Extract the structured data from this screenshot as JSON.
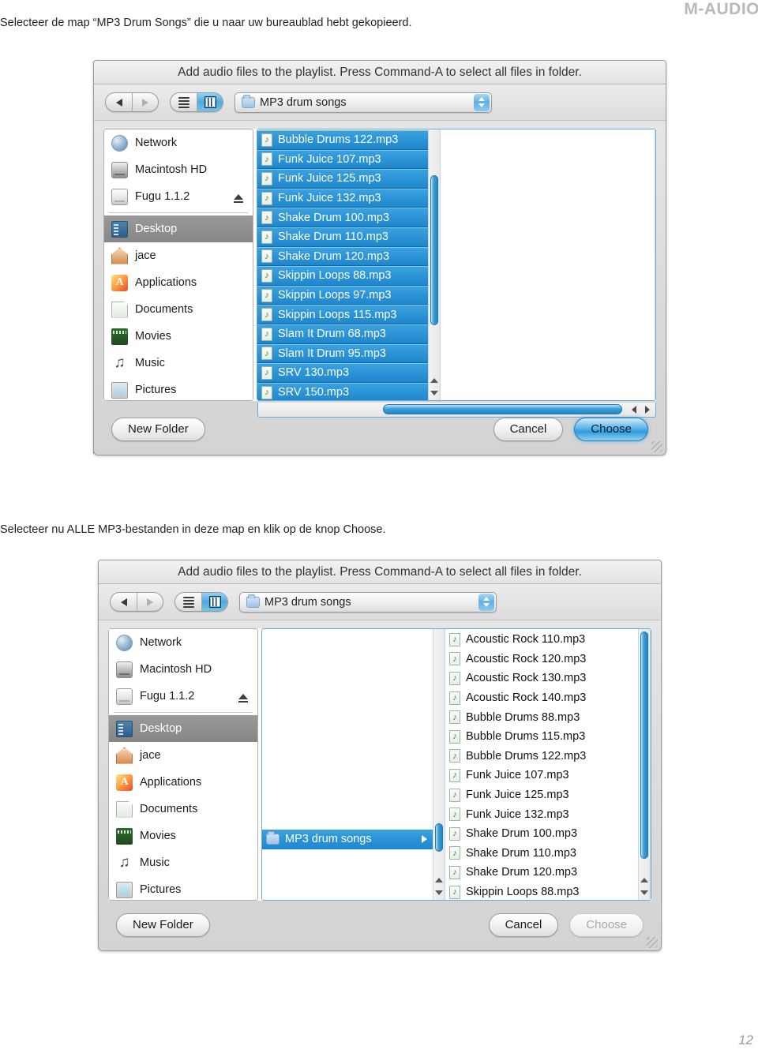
{
  "brand": {
    "logo_text": "M-AUDIO"
  },
  "page": {
    "number": "12"
  },
  "instructions": {
    "line1": "Selecteer de map “MP3 Drum Songs” die u naar uw bureaublad hebt gekopieerd.",
    "line2": "Selecteer nu ALLE MP3-bestanden in deze map en klik op de knop Choose."
  },
  "dialog1": {
    "title": "Add audio files to the playlist. Press Command-A to select all files in folder.",
    "toolbar": {
      "back_icon": "triangle-left-icon",
      "forward_icon": "triangle-right-icon",
      "view_list_icon": "list-view-icon",
      "view_column_icon": "column-view-icon",
      "path_popup_value": "MP3 drum songs",
      "path_popup_icon": "folder-icon",
      "path_popup_arrows_icon": "updown-arrows-icon"
    },
    "sidebar": [
      {
        "label": "Network",
        "icon": "network-globe-icon",
        "selected": false,
        "eject": false
      },
      {
        "label": "Macintosh HD",
        "icon": "hard-disk-icon",
        "selected": false,
        "eject": false
      },
      {
        "label": "Fugu 1.1.2",
        "icon": "removable-disk-icon",
        "selected": false,
        "eject": true
      },
      {
        "label": "Desktop",
        "icon": "desktop-icon",
        "selected": true,
        "eject": false
      },
      {
        "label": "jace",
        "icon": "home-icon",
        "selected": false,
        "eject": false
      },
      {
        "label": "Applications",
        "icon": "applications-icon",
        "selected": false,
        "eject": false
      },
      {
        "label": "Documents",
        "icon": "documents-icon",
        "selected": false,
        "eject": false
      },
      {
        "label": "Movies",
        "icon": "movies-icon",
        "selected": false,
        "eject": false
      },
      {
        "label": "Music",
        "icon": "music-icon",
        "selected": false,
        "eject": false
      },
      {
        "label": "Pictures",
        "icon": "pictures-icon",
        "selected": false,
        "eject": false
      }
    ],
    "files": [
      {
        "name": "Bubble Drums 122.mp3",
        "selected": true
      },
      {
        "name": "Funk Juice 107.mp3",
        "selected": true
      },
      {
        "name": "Funk Juice 125.mp3",
        "selected": true
      },
      {
        "name": "Funk Juice 132.mp3",
        "selected": true
      },
      {
        "name": "Shake Drum 100.mp3",
        "selected": true
      },
      {
        "name": "Shake Drum 110.mp3",
        "selected": true
      },
      {
        "name": "Shake Drum 120.mp3",
        "selected": true
      },
      {
        "name": "Skippin Loops 88.mp3",
        "selected": true
      },
      {
        "name": "Skippin Loops 97.mp3",
        "selected": true
      },
      {
        "name": "Skippin Loops 115.mp3",
        "selected": true
      },
      {
        "name": "Slam It Drum 68.mp3",
        "selected": true
      },
      {
        "name": "Slam It Drum 95.mp3",
        "selected": true
      },
      {
        "name": "SRV 130.mp3",
        "selected": true
      },
      {
        "name": "SRV 150.mp3",
        "selected": true
      }
    ],
    "footer": {
      "new_folder_label": "New Folder",
      "cancel_label": "Cancel",
      "choose_label": "Choose",
      "choose_enabled": true
    }
  },
  "dialog2": {
    "title": "Add audio files to the playlist. Press Command-A to select all files in folder.",
    "toolbar": {
      "back_icon": "triangle-left-icon",
      "forward_icon": "triangle-right-icon",
      "view_list_icon": "list-view-icon",
      "view_column_icon": "column-view-icon",
      "path_popup_value": "MP3 drum songs",
      "path_popup_icon": "folder-icon",
      "path_popup_arrows_icon": "updown-arrows-icon"
    },
    "sidebar": [
      {
        "label": "Network",
        "icon": "network-globe-icon",
        "selected": false,
        "eject": false
      },
      {
        "label": "Macintosh HD",
        "icon": "hard-disk-icon",
        "selected": false,
        "eject": false
      },
      {
        "label": "Fugu 1.1.2",
        "icon": "removable-disk-icon",
        "selected": false,
        "eject": true
      },
      {
        "label": "Desktop",
        "icon": "desktop-icon",
        "selected": true,
        "eject": false
      },
      {
        "label": "jace",
        "icon": "home-icon",
        "selected": false,
        "eject": false
      },
      {
        "label": "Applications",
        "icon": "applications-icon",
        "selected": false,
        "eject": false
      },
      {
        "label": "Documents",
        "icon": "documents-icon",
        "selected": false,
        "eject": false
      },
      {
        "label": "Movies",
        "icon": "movies-icon",
        "selected": false,
        "eject": false
      },
      {
        "label": "Music",
        "icon": "music-icon",
        "selected": false,
        "eject": false
      },
      {
        "label": "Pictures",
        "icon": "pictures-icon",
        "selected": false,
        "eject": false
      }
    ],
    "folder_column": {
      "folder_label": "MP3 drum songs",
      "folder_icon": "folder-icon",
      "disclosure_icon": "triangle-right-icon",
      "selected": true
    },
    "files": [
      {
        "name": "Acoustic Rock 110.mp3",
        "selected": false
      },
      {
        "name": "Acoustic Rock 120.mp3",
        "selected": false
      },
      {
        "name": "Acoustic Rock 130.mp3",
        "selected": false
      },
      {
        "name": "Acoustic Rock 140.mp3",
        "selected": false
      },
      {
        "name": "Bubble Drums 88.mp3",
        "selected": false
      },
      {
        "name": "Bubble Drums 115.mp3",
        "selected": false
      },
      {
        "name": "Bubble Drums 122.mp3",
        "selected": false
      },
      {
        "name": "Funk Juice 107.mp3",
        "selected": false
      },
      {
        "name": "Funk Juice 125.mp3",
        "selected": false
      },
      {
        "name": "Funk Juice 132.mp3",
        "selected": false
      },
      {
        "name": "Shake Drum 100.mp3",
        "selected": false
      },
      {
        "name": "Shake Drum 110.mp3",
        "selected": false
      },
      {
        "name": "Shake Drum 120.mp3",
        "selected": false
      },
      {
        "name": "Skippin Loops 88.mp3",
        "selected": false
      }
    ],
    "footer": {
      "new_folder_label": "New Folder",
      "cancel_label": "Cancel",
      "choose_label": "Choose",
      "choose_enabled": false
    }
  },
  "colors": {
    "selection_blue": "#1e86cb",
    "sidebar_selection_gray": "#8d8d8d",
    "default_button_blue": "#2f9ade",
    "brand_gray": "#b9b9bb"
  }
}
